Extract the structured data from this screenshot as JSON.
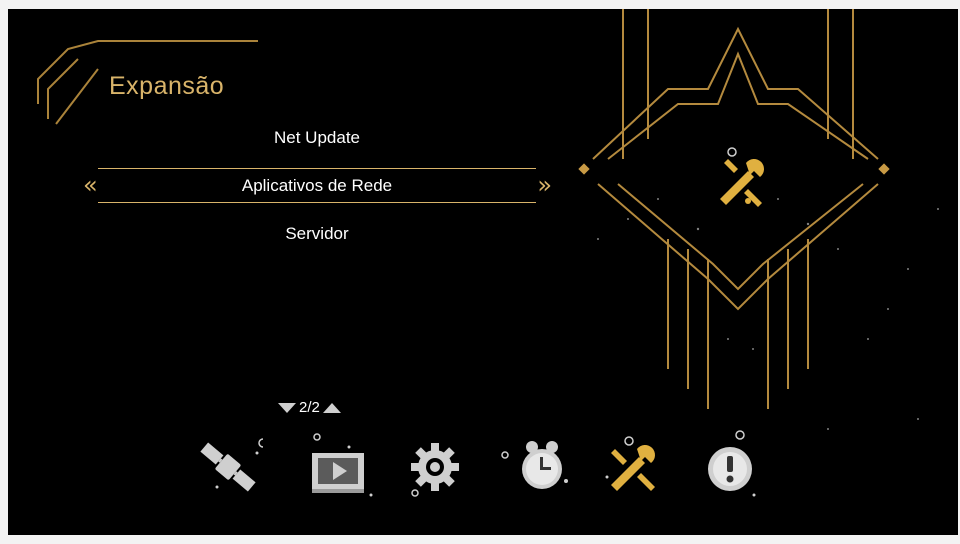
{
  "screen": {
    "title": "Expansão"
  },
  "menu": {
    "items": [
      {
        "label": "Net Update"
      },
      {
        "label": "Aplicativos de Rede"
      },
      {
        "label": "Servidor"
      }
    ]
  },
  "arrows": {
    "left": "«",
    "right": "»"
  },
  "pager": {
    "text": "2/2"
  },
  "bottom_nav": {
    "icons": [
      "satellite-icon",
      "media-icon",
      "settings-gear-icon",
      "alarm-clock-icon",
      "tools-wrench-icon",
      "info-icon"
    ],
    "active": "tools-wrench-icon"
  },
  "colors": {
    "accent": "#d9b46a",
    "background": "#000000",
    "icon_inactive": "#cfcfcf"
  }
}
